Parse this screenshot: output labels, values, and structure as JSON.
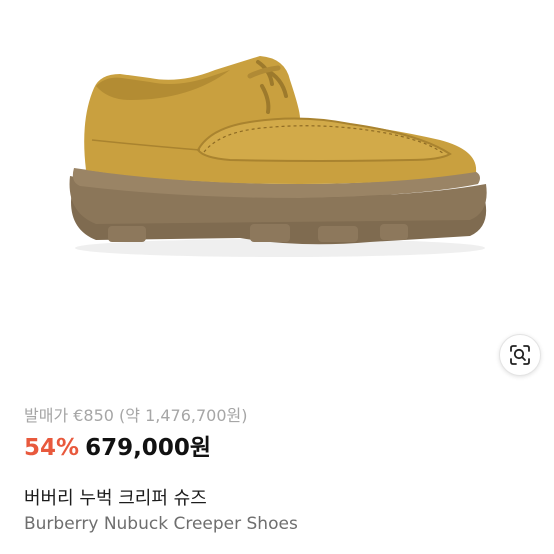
{
  "product": {
    "image_alt": "Burberry nubuck creeper shoe, mustard yellow with brown sole",
    "original_price": "발매가 €850 (약 1,476,700원)",
    "discount": "54%",
    "sale_price": "679,000원",
    "title_ko": "버버리 누벅 크리퍼 슈즈",
    "title_en": "Burberry Nubuck Creeper Shoes"
  },
  "icons": {
    "lens": "image-search-icon"
  },
  "colors": {
    "discount": "#e8593d",
    "upper": "#c9a03f",
    "sole": "#8b7659"
  }
}
